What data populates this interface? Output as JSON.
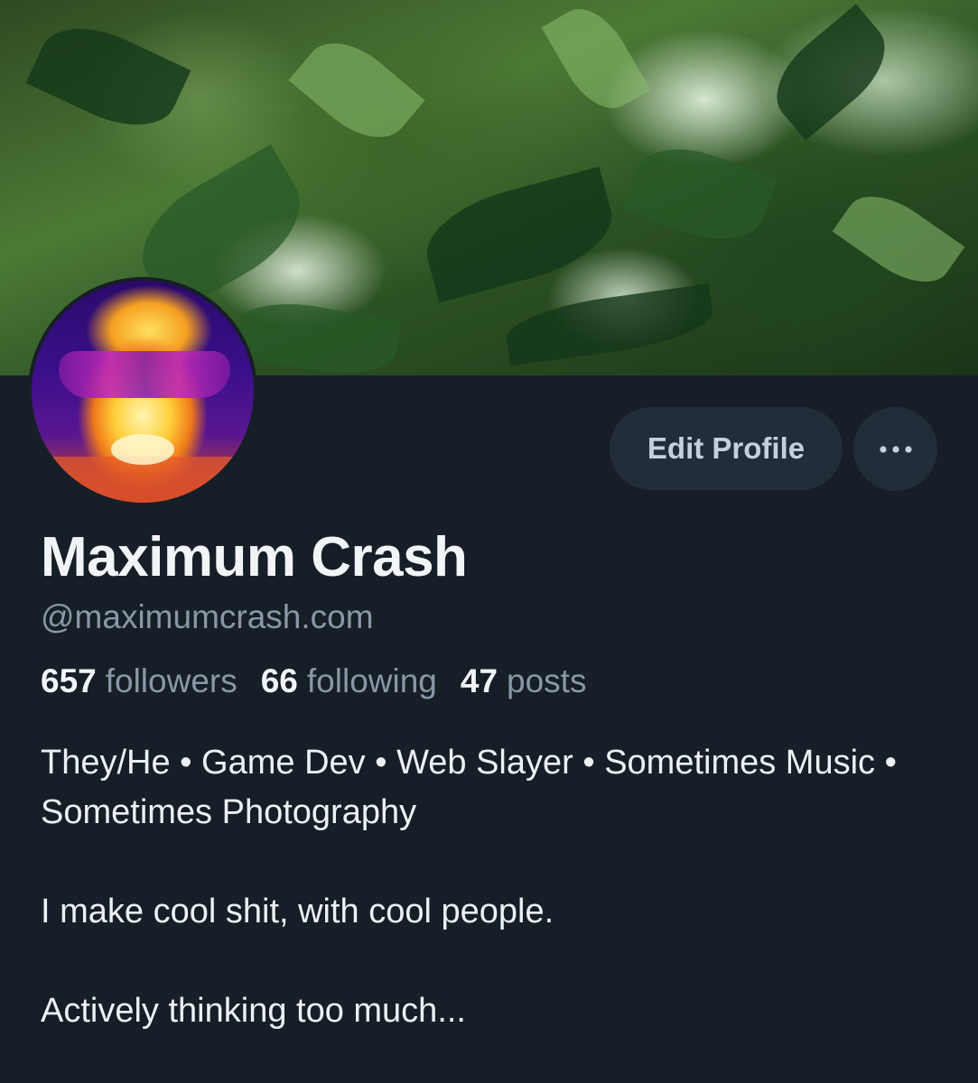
{
  "profile": {
    "display_name": "Maximum Crash",
    "handle": "@maximumcrash.com",
    "edit_profile_label": "Edit Profile",
    "more_label": "•••",
    "stats": {
      "followers_count": "657",
      "followers_label": "followers",
      "following_count": "66",
      "following_label": "following",
      "posts_count": "47",
      "posts_label": "posts"
    },
    "bio": {
      "line1": "They/He • Game Dev • Web Slayer • Sometimes Music • Sometimes Photography",
      "line2": "I make cool shit, with cool people.",
      "line3": "Actively thinking too much..."
    }
  },
  "colors": {
    "background": "#161e27",
    "button_bg": "#222d39",
    "text_primary": "#f2f5f8",
    "text_muted": "#8a97a6"
  },
  "icons": {
    "banner": "leaf-photo-banner",
    "avatar": "thermal-avatar",
    "more": "ellipsis-icon"
  }
}
